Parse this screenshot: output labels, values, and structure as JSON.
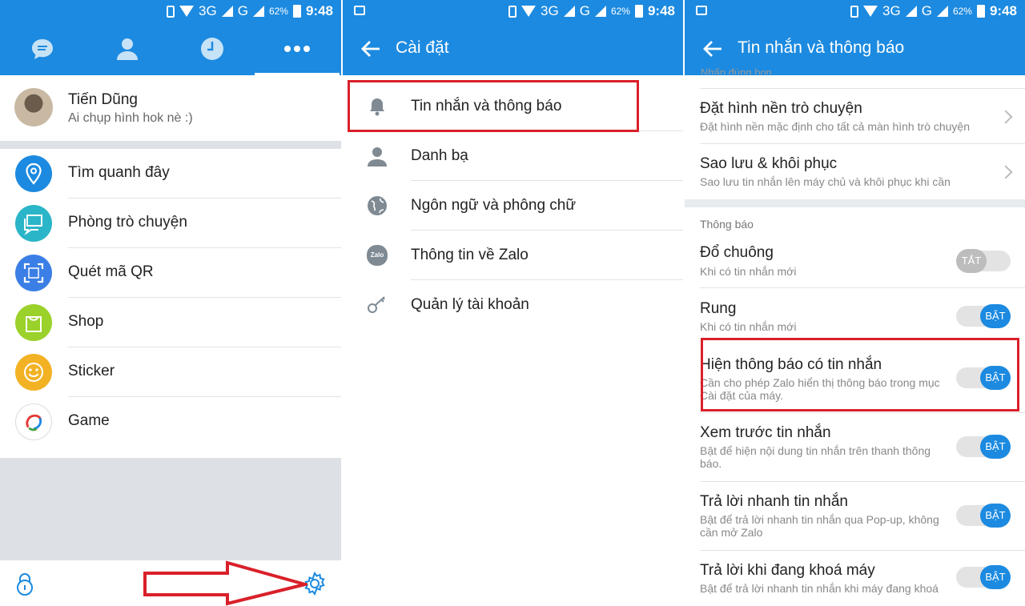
{
  "colors": {
    "primary": "#1c8ae0",
    "highlight": "#d9202a"
  },
  "status_bar": {
    "network": "3G",
    "network2": "G",
    "battery": "62%",
    "time": "9:48"
  },
  "panel1": {
    "tabs": [
      "messages-icon",
      "contacts-icon",
      "clock-icon",
      "more-icon"
    ],
    "profile": {
      "name": "Tiến Dũng",
      "status": "Ai chụp hình hok nè :)"
    },
    "menu": [
      {
        "label": "Tìm quanh đây",
        "icon": "location-pin-icon",
        "color": "#1c8ae0"
      },
      {
        "label": "Phòng trò chuyện",
        "icon": "chat-room-icon",
        "color": "#2bb5c8"
      },
      {
        "label": "Quét mã QR",
        "icon": "qr-scan-icon",
        "color": "#3b7fe6"
      },
      {
        "label": "Shop",
        "icon": "shop-bag-icon",
        "color": "#9ad12a"
      },
      {
        "label": "Sticker",
        "icon": "smiley-icon",
        "color": "#f2b224"
      },
      {
        "label": "Game",
        "icon": "game-logo-icon",
        "color": "#ffffff"
      }
    ]
  },
  "panel2": {
    "title": "Cài đặt",
    "items": [
      {
        "label": "Tin nhắn và thông báo",
        "icon": "bell-icon"
      },
      {
        "label": "Danh bạ",
        "icon": "person-icon"
      },
      {
        "label": "Ngôn ngữ và phông chữ",
        "icon": "globe-icon"
      },
      {
        "label": "Thông tin về Zalo",
        "icon": "zalo-icon",
        "icon_text": "Zalo"
      },
      {
        "label": "Quản lý tài khoản",
        "icon": "key-icon"
      }
    ]
  },
  "panel3": {
    "title": "Tin nhắn và thông báo",
    "top_cut": "Nhấn đúng bọn...",
    "rows": [
      {
        "title": "Đặt hình nền trò chuyện",
        "sub": "Đặt hình nền mặc định cho tất cả màn hình trò chuyện"
      },
      {
        "title": "Sao lưu & khôi phục",
        "sub": "Sao lưu tin nhắn lên máy chủ và khôi phục khi cần"
      }
    ],
    "section": "Thông báo",
    "toggles": [
      {
        "title": "Đổ chuông",
        "sub": "Khi có tin nhắn mới",
        "state": "TẮT",
        "on": false
      },
      {
        "title": "Rung",
        "sub": "Khi có tin nhắn mới",
        "state": "BẬT",
        "on": true
      },
      {
        "title": "Hiện thông báo có tin nhắn",
        "sub": "Cần cho phép Zalo hiển thị thông báo trong mục Cài đặt của máy.",
        "state": "BẬT",
        "on": true
      },
      {
        "title": "Xem trước tin nhắn",
        "sub": "Bật để hiện nội dung tin nhắn trên thanh thông báo.",
        "state": "BẬT",
        "on": true
      },
      {
        "title": "Trả lời nhanh tin nhắn",
        "sub": "Bật để trả lời nhanh tin nhắn qua Pop-up, không cần mở Zalo",
        "state": "BẬT",
        "on": true
      },
      {
        "title": "Trả lời khi đang khoá máy",
        "sub": "Bật để trả lời nhanh tin nhắn khi máy đang khoá",
        "state": "BẬT",
        "on": true
      }
    ]
  }
}
